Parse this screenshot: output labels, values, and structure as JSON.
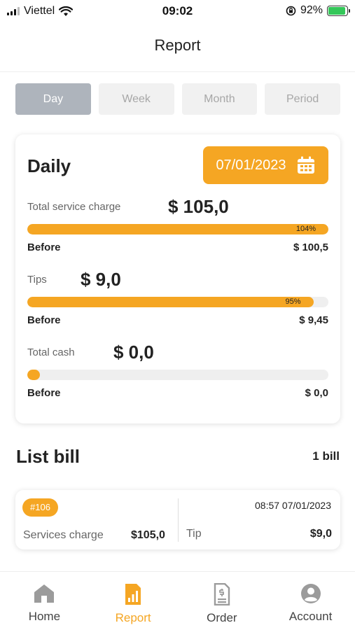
{
  "status_bar": {
    "carrier": "Viettel",
    "time": "09:02",
    "battery_percent": "92%",
    "battery_level": 0.92
  },
  "header": {
    "title": "Report"
  },
  "period_tabs": [
    {
      "label": "Day",
      "active": true
    },
    {
      "label": "Week",
      "active": false
    },
    {
      "label": "Month",
      "active": false
    },
    {
      "label": "Period",
      "active": false
    }
  ],
  "daily_card": {
    "title": "Daily",
    "date": "07/01/2023",
    "metrics": [
      {
        "label": "Total service charge",
        "value": "$ 105,0",
        "progress_label": "104%",
        "progress_fraction": 1.0,
        "before_label": "Before",
        "before_value": "$ 100,5"
      },
      {
        "label": "Tips",
        "value": "$ 9,0",
        "progress_label": "95%",
        "progress_fraction": 0.95,
        "before_label": "Before",
        "before_value": "$ 9,45"
      },
      {
        "label": "Total cash",
        "value": "$ 0,0",
        "progress_label": "",
        "progress_fraction": 0.0,
        "before_label": "Before",
        "before_value": "$ 0,0"
      }
    ]
  },
  "list_bill": {
    "title": "List bill",
    "count": "1 bill",
    "bills": [
      {
        "id": "#106",
        "datetime": "08:57 07/01/2023",
        "service_label": "Services charge",
        "service_amount": "$105,0",
        "tip_label": "Tip",
        "tip_amount": "$9,0"
      }
    ]
  },
  "tab_bar": [
    {
      "label": "Home",
      "icon": "home-icon",
      "active": false
    },
    {
      "label": "Report",
      "icon": "bar-chart-icon",
      "active": true
    },
    {
      "label": "Order",
      "icon": "receipt-icon",
      "active": false
    },
    {
      "label": "Account",
      "icon": "user-icon",
      "active": false
    }
  ],
  "colors": {
    "accent": "#f5a623",
    "active_segment": "#aeb4bc",
    "track": "#efefef"
  }
}
